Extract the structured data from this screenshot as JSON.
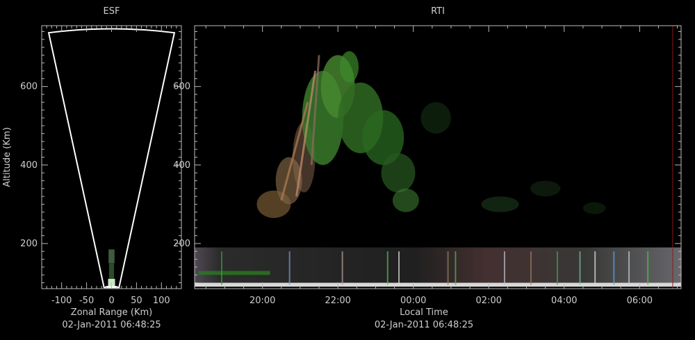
{
  "chart_data": [
    {
      "type": "scatter",
      "title": "ESF",
      "xlabel": "Zonal Range (Km)",
      "ylabel": "Altitude (Km)",
      "timestamp": "02-Jan-2011 06:48:25",
      "xlim": [
        -140,
        140
      ],
      "ylim": [
        85,
        755
      ],
      "x_ticks": [
        {
          "value": -100,
          "label": "-100"
        },
        {
          "value": -50,
          "label": "-50"
        },
        {
          "value": 0,
          "label": "0"
        },
        {
          "value": 50,
          "label": "50"
        },
        {
          "value": 100,
          "label": "100"
        }
      ],
      "y_ticks": [
        {
          "value": 200,
          "label": "200"
        },
        {
          "value": 400,
          "label": "400"
        },
        {
          "value": 600,
          "label": "600"
        }
      ],
      "beam_sector": {
        "apex_left": [
          -15,
          88
        ],
        "apex_right": [
          15,
          88
        ],
        "top_left": [
          -126,
          737
        ],
        "top_right": [
          126,
          737
        ],
        "arc_top": 747
      }
    },
    {
      "type": "heatmap",
      "title": "RTI",
      "xlabel": "Local Time",
      "timestamp": "02-Jan-2011 06:48:25",
      "xlim_hours": [
        18.2,
        31.1
      ],
      "ylim": [
        85,
        755
      ],
      "x_ticks": [
        {
          "value": 20,
          "label": "20:00"
        },
        {
          "value": 22,
          "label": "22:00"
        },
        {
          "value": 24,
          "label": "00:00"
        },
        {
          "value": 26,
          "label": "02:00"
        },
        {
          "value": 28,
          "label": "04:00"
        },
        {
          "value": 30,
          "label": "06:00"
        }
      ],
      "y_ticks": [
        {
          "value": 200,
          "label": "200"
        },
        {
          "value": 400,
          "label": "400"
        },
        {
          "value": 600,
          "label": "600"
        }
      ]
    }
  ]
}
